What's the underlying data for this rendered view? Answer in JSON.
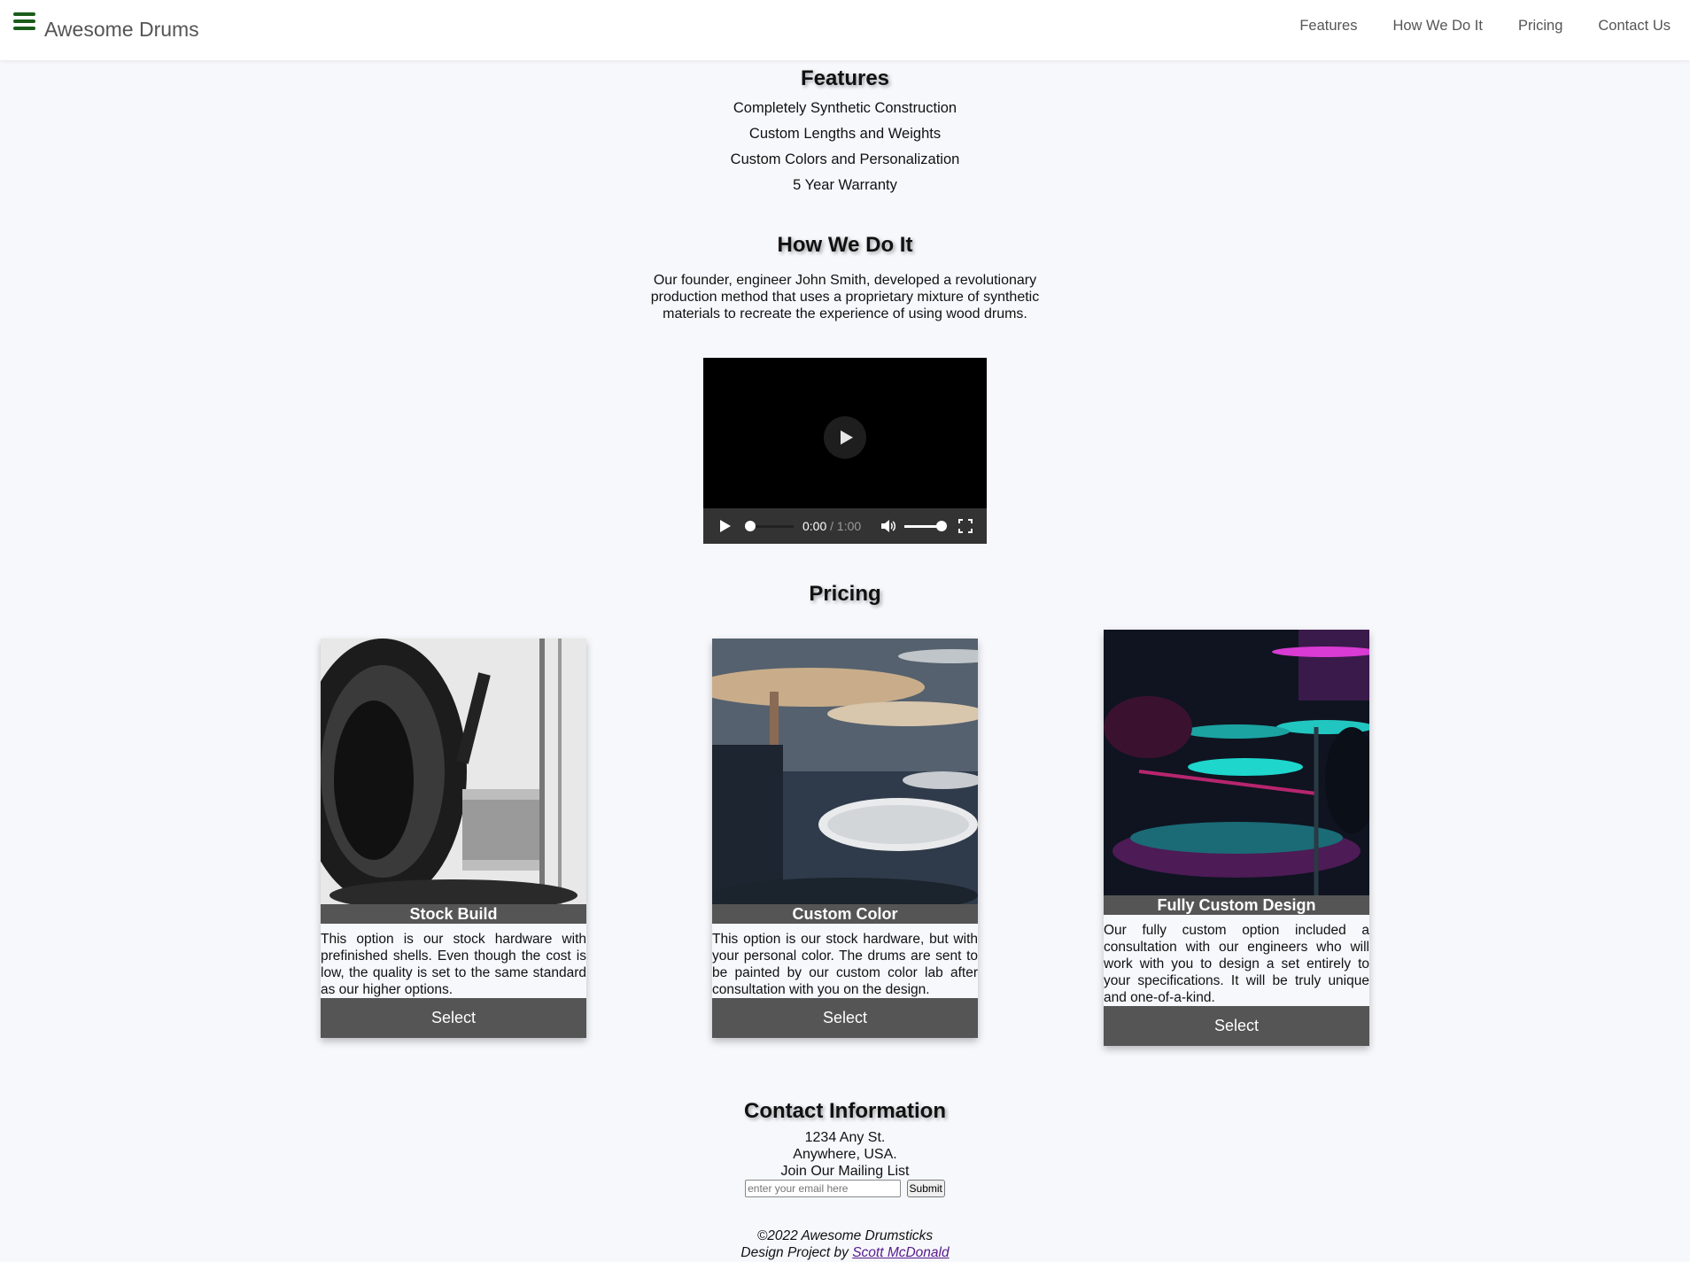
{
  "navbar": {
    "brand": "Awesome Drums",
    "links": [
      "Features",
      "How We Do It",
      "Pricing",
      "Contact Us"
    ],
    "accent_color": "#1a5c1a"
  },
  "features": {
    "title": "Features",
    "items": [
      "Completely Synthetic Construction",
      "Custom Lengths and Weights",
      "Custom Colors and Personalization",
      "5 Year Warranty"
    ]
  },
  "how": {
    "title": "How We Do It",
    "text": "Our founder, engineer John Smith, developed a revolutionary production method that uses a proprietary mixture of synthetic materials to recreate the experience of using wood drums."
  },
  "video": {
    "current_time": "0:00",
    "duration": "/ 1:00",
    "progress": 0,
    "volume": 1
  },
  "pricing": {
    "title": "Pricing",
    "cards": [
      {
        "label": "Stock Build",
        "text": "This option is our stock hardware with prefinished shells. Even though the cost is low, the quality is set to the same standard as our higher options.",
        "button": "Select"
      },
      {
        "label": "Custom Color",
        "text": "This option is our stock hardware, but with your personal color. The drums are sent to be painted by our custom color lab after consultation with you on the design.",
        "button": "Select"
      },
      {
        "label": "Fully Custom Design",
        "text": "Our fully custom option included a consultation with our engineers who will work with you to design a set entirely to your specifications. It will be truly unique and one-of-a-kind.",
        "button": "Select"
      }
    ]
  },
  "contact": {
    "title": "Contact Information",
    "address1": "1234 Any St.",
    "address2": "Anywhere, USA.",
    "mailing": "Join Our Mailing List",
    "email_placeholder": "enter your email here",
    "submit": "Submit"
  },
  "footer": {
    "copyright": "©2022 Awesome Drumsticks",
    "credit_prefix": "Design Project by",
    "credit_name": "Scott McDonald"
  }
}
